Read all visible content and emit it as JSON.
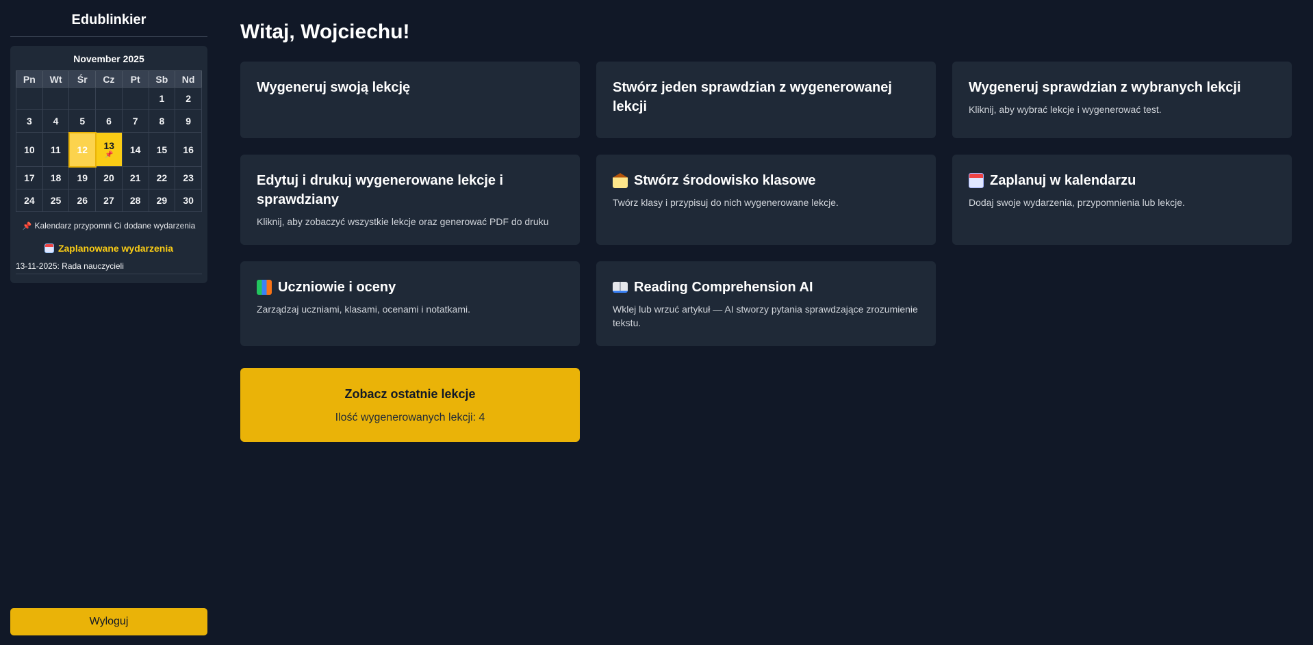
{
  "app": {
    "brand": "Edublinkier"
  },
  "calendar": {
    "month_label": "November 2025",
    "weekdays": [
      "Pn",
      "Wt",
      "Śr",
      "Cz",
      "Pt",
      "Sb",
      "Nd"
    ],
    "weeks": [
      [
        "",
        "",
        "",
        "",
        "",
        "1",
        "2"
      ],
      [
        "3",
        "4",
        "5",
        "6",
        "7",
        "8",
        "9"
      ],
      [
        "10",
        "11",
        "12",
        "13",
        "14",
        "15",
        "16"
      ],
      [
        "17",
        "18",
        "19",
        "20",
        "21",
        "22",
        "23"
      ],
      [
        "24",
        "25",
        "26",
        "27",
        "28",
        "29",
        "30"
      ]
    ],
    "today": "12",
    "event_day": "13",
    "event_marker": "📌",
    "reminder_icon": "pin-icon",
    "reminder_note": "Kalendarz przypomni Ci dodane wydarzenia",
    "events_title": "Zaplanowane wydarzenia",
    "events": [
      "13-11-2025: Rada nauczycieli"
    ]
  },
  "sidebar": {
    "logout_label": "Wyloguj"
  },
  "main": {
    "greeting": "Witaj, Wojciechu!",
    "cards": [
      {
        "title": "Wygeneruj swoją lekcję",
        "desc": ""
      },
      {
        "title": "Stwórz jeden sprawdzian z wygenerowanej lekcji",
        "desc": ""
      },
      {
        "title": "Wygeneruj sprawdzian z wybranych lekcji",
        "desc": "Kliknij, aby wybrać lekcje i wygenerować test."
      },
      {
        "title": "Edytuj i drukuj wygenerowane lekcje i sprawdziany",
        "desc": "Kliknij, aby zobaczyć wszystkie lekcje oraz generować PDF do druku"
      },
      {
        "title": "Stwórz środowisko klasowe",
        "desc": "Twórz klasy i przypisuj do nich wygenerowane lekcje.",
        "icon": "school-icon"
      },
      {
        "title": "Zaplanuj w kalendarzu",
        "desc": "Dodaj swoje wydarzenia, przypomnienia lub lekcje.",
        "icon": "calendar-icon"
      },
      {
        "title": "Uczniowie i oceny",
        "desc": "Zarządzaj uczniami, klasami, ocenami i notatkami.",
        "icon": "books-icon"
      },
      {
        "title": "Reading Comprehension AI",
        "desc": "Wklej lub wrzuć artykuł — AI stworzy pytania sprawdzające zrozumienie tekstu.",
        "icon": "open-book-icon"
      }
    ],
    "recent": {
      "title": "Zobacz ostatnie lekcje",
      "count_label": "Ilość wygenerowanych lekcji: 4"
    }
  },
  "colors": {
    "background": "#111827",
    "panel": "#1f2937",
    "accent": "#eab308",
    "event_highlight": "#facc15"
  }
}
